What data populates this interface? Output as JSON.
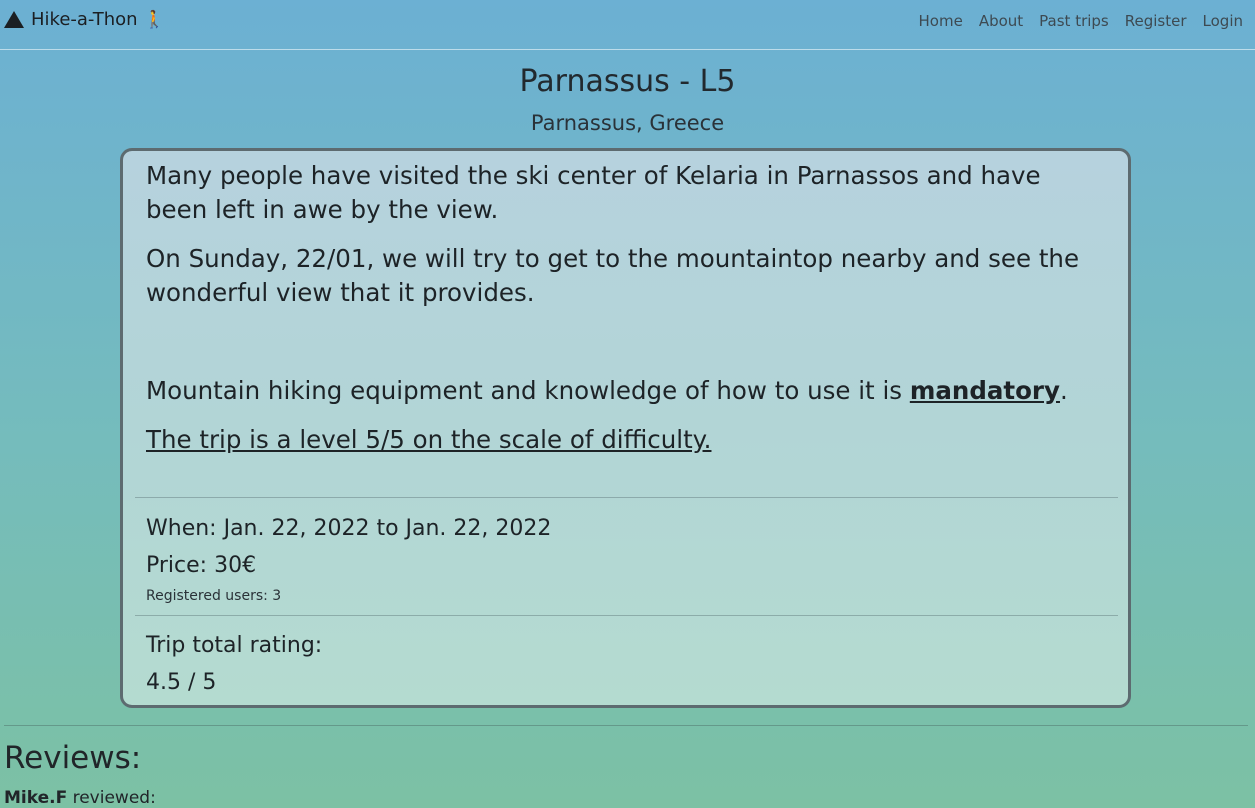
{
  "navbar": {
    "brand": "Hike-a-Thon",
    "brand_hiker_glyph": "🚶",
    "links": [
      "Home",
      "About",
      "Past trips",
      "Register",
      "Login"
    ]
  },
  "trip": {
    "title": "Parnassus - L5",
    "location": "Parnassus, Greece",
    "description": {
      "p1": "Many people have visited the ski center of Kelaria in Parnassos and have been left in awe by the view.",
      "p2": "On Sunday, 22/01, we will try to get to the mountaintop nearby and see the wonderful view that it provides.",
      "p3_before": "Mountain hiking equipment and knowledge of how to use it is ",
      "p3_bold": "mandatory",
      "p3_after": ".",
      "p4": "The trip is a level 5/5 on the scale of difficulty."
    },
    "when": "When: Jan. 22, 2022 to Jan. 22, 2022",
    "price": "Price: 30€",
    "registered": "Registered users: 3",
    "rating_label": "Trip total rating:",
    "rating_value": "4.5 / 5"
  },
  "reviews": {
    "title": "Reviews:",
    "items": [
      {
        "author": "Mike.F",
        "text": " reviewed:"
      }
    ]
  },
  "icons": {
    "brand_icon": "mountain-icon",
    "hiker_icon": "hiker-icon"
  }
}
